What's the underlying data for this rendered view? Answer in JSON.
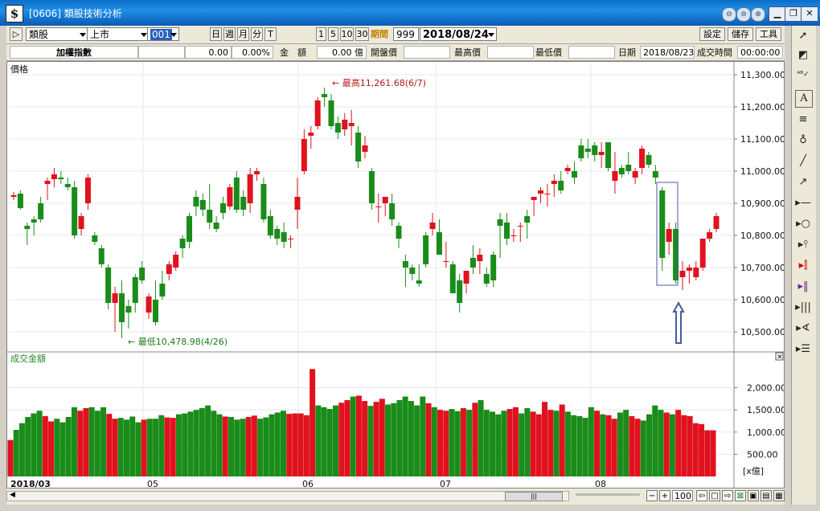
{
  "window": {
    "title": "[0606] 類股技術分析",
    "app_icon": "$",
    "controls": [
      "⊖",
      "⊜",
      "⊕"
    ],
    "min": "▁",
    "max": "❐",
    "close": "✕"
  },
  "toolbar": {
    "play_icon": "▷",
    "category": "類股",
    "market": "上市",
    "code": "001",
    "periods": [
      "日",
      "週",
      "月",
      "分",
      "T"
    ],
    "minutes": [
      "1",
      "5",
      "10",
      "30"
    ],
    "period_label": "期間",
    "period_value": "999",
    "date": "2018/08/24",
    "settings": "設定",
    "save": "儲存",
    "tools": "工具"
  },
  "info": {
    "index_name": "加權指數",
    "change": "0.00",
    "change_pct": "0.00%",
    "amount_label": "金　額",
    "amount_value": "0.00 億",
    "open_label": "開盤價",
    "high_label": "最高價",
    "low_label": "最低價",
    "date_label": "日期",
    "date_value": "2018/08/23",
    "time_label": "成交時間",
    "time_value": "00:00:00"
  },
  "price_panel": {
    "title": "價格",
    "max_label": "← 最高11,261.68(6/7)",
    "min_label": "← 最低10,478.98(4/26)"
  },
  "volume_panel": {
    "title": "成交金額",
    "unit": "[x億]",
    "close": "✕"
  },
  "bottom": {
    "zoom": "100",
    "scroll_grip": "|||"
  },
  "colors": {
    "up": "#e0121e",
    "down": "#1a8c1a",
    "highlight": "#4a5aa0"
  },
  "right_tools": [
    "cursor-icon",
    "eraser-icon",
    "spellcheck-icon",
    "text-icon",
    "equals-icon",
    "color-icon",
    "line-icon",
    "arrow-icon",
    "hline-icon",
    "circle-icon",
    "pin-icon",
    "candles-icon",
    "bars-icon",
    "lines-icon",
    "fan-icon",
    "fib-icon"
  ],
  "chart_data": [
    {
      "type": "candlestick",
      "x_ticks": [
        "2018/03",
        "05",
        "06",
        "07",
        "08"
      ],
      "y_ticks": [
        "11,300.00",
        "11,200.00",
        "11,100.00",
        "11,000.00",
        "10,900.00",
        "10,800.00",
        "10,700.00",
        "10,600.00",
        "10,500.00"
      ],
      "ylim": [
        10440,
        11330
      ],
      "grid": true,
      "candles": [
        [
          10920,
          10935,
          10910,
          10925
        ],
        [
          10930,
          10940,
          10880,
          10885
        ],
        [
          10830,
          10840,
          10770,
          10820
        ],
        [
          10850,
          10860,
          10800,
          10840
        ],
        [
          10900,
          10920,
          10840,
          10850
        ],
        [
          10960,
          10980,
          10910,
          10970
        ],
        [
          10975,
          11010,
          10950,
          10990
        ],
        [
          10980,
          11000,
          10960,
          10975
        ],
        [
          10960,
          10980,
          10940,
          10950
        ],
        [
          10950,
          10970,
          10790,
          10800
        ],
        [
          10820,
          10870,
          10800,
          10860
        ],
        [
          10900,
          10990,
          10880,
          10980
        ],
        [
          10800,
          10810,
          10770,
          10780
        ],
        [
          10760,
          10770,
          10700,
          10710
        ],
        [
          10700,
          10710,
          10570,
          10590
        ],
        [
          10590,
          10640,
          10500,
          10620
        ],
        [
          10620,
          10660,
          10480,
          10530
        ],
        [
          10580,
          10600,
          10510,
          10560
        ],
        [
          10670,
          10680,
          10560,
          10590
        ],
        [
          10700,
          10720,
          10650,
          10660
        ],
        [
          10560,
          10620,
          10540,
          10610
        ],
        [
          10600,
          10660,
          10520,
          10530
        ],
        [
          10650,
          10690,
          10600,
          10610
        ],
        [
          10680,
          10720,
          10660,
          10710
        ],
        [
          10700,
          10750,
          10690,
          10740
        ],
        [
          10790,
          10800,
          10730,
          10760
        ],
        [
          10860,
          10870,
          10760,
          10780
        ],
        [
          10920,
          10940,
          10860,
          10890
        ],
        [
          10910,
          10930,
          10860,
          10880
        ],
        [
          10880,
          10960,
          10820,
          10840
        ],
        [
          10840,
          10860,
          10810,
          10820
        ],
        [
          10900,
          10920,
          10850,
          10870
        ],
        [
          10890,
          10960,
          10880,
          10950
        ],
        [
          10980,
          11000,
          10870,
          10880
        ],
        [
          10920,
          10940,
          10860,
          10880
        ],
        [
          10900,
          11010,
          10870,
          10990
        ],
        [
          10990,
          11010,
          10970,
          11000
        ],
        [
          10960,
          10980,
          10840,
          10850
        ],
        [
          10860,
          10880,
          10790,
          10800
        ],
        [
          10820,
          10830,
          10770,
          10790
        ],
        [
          10810,
          10840,
          10760,
          10780
        ],
        [
          10790,
          10800,
          10760,
          10790
        ],
        [
          10880,
          10980,
          10820,
          10920
        ],
        [
          11000,
          11130,
          10990,
          11100
        ],
        [
          11110,
          11140,
          11070,
          11120
        ],
        [
          11140,
          11230,
          11130,
          11220
        ],
        [
          11240,
          11260,
          11200,
          11230
        ],
        [
          11220,
          11240,
          11130,
          11140
        ],
        [
          11150,
          11170,
          11100,
          11120
        ],
        [
          11130,
          11180,
          11110,
          11160
        ],
        [
          11140,
          11190,
          11080,
          11150
        ],
        [
          11120,
          11140,
          11010,
          11030
        ],
        [
          11060,
          11110,
          11040,
          11080
        ],
        [
          11000,
          11010,
          10880,
          10900
        ],
        [
          10890,
          10930,
          10840,
          10890
        ],
        [
          10900,
          10920,
          10860,
          10920
        ],
        [
          10900,
          10930,
          10830,
          10850
        ],
        [
          10830,
          10840,
          10760,
          10790
        ],
        [
          10720,
          10740,
          10640,
          10700
        ],
        [
          10700,
          10710,
          10660,
          10680
        ],
        [
          10660,
          10710,
          10640,
          10650
        ],
        [
          10800,
          10810,
          10700,
          10710
        ],
        [
          10820,
          10870,
          10800,
          10840
        ],
        [
          10810,
          10850,
          10760,
          10740
        ],
        [
          10720,
          10780,
          10700,
          10720
        ],
        [
          10710,
          10720,
          10620,
          10620
        ],
        [
          10660,
          10680,
          10560,
          10590
        ],
        [
          10650,
          10680,
          10620,
          10690
        ],
        [
          10730,
          10770,
          10680,
          10700
        ],
        [
          10720,
          10760,
          10680,
          10740
        ],
        [
          10680,
          10700,
          10640,
          10650
        ],
        [
          10740,
          10750,
          10640,
          10660
        ],
        [
          10850,
          10870,
          10730,
          10830
        ],
        [
          10840,
          10870,
          10770,
          10790
        ],
        [
          10800,
          10820,
          10780,
          10800
        ],
        [
          10830,
          10840,
          10780,
          10830
        ],
        [
          10860,
          10880,
          10790,
          10840
        ],
        [
          10910,
          10920,
          10860,
          10920
        ],
        [
          10930,
          10950,
          10900,
          10940
        ],
        [
          10930,
          10960,
          10890,
          10930
        ],
        [
          10960,
          10990,
          10920,
          10970
        ],
        [
          10970,
          11000,
          10930,
          10940
        ],
        [
          11000,
          11020,
          10990,
          11010
        ],
        [
          11000,
          11030,
          10960,
          10980
        ],
        [
          11080,
          11100,
          11030,
          11040
        ],
        [
          11070,
          11100,
          11040,
          11060
        ],
        [
          11080,
          11090,
          11030,
          11050
        ],
        [
          11050,
          11090,
          11010,
          11060
        ],
        [
          11090,
          11090,
          11000,
          11010
        ],
        [
          10970,
          11060,
          10930,
          11000
        ],
        [
          11010,
          11020,
          10980,
          10990
        ],
        [
          11020,
          11060,
          10990,
          11000
        ],
        [
          10980,
          11010,
          10960,
          11000
        ],
        [
          11010,
          11080,
          10990,
          11070
        ],
        [
          11050,
          11060,
          11010,
          11020
        ],
        [
          11000,
          11020,
          10960,
          10980
        ],
        [
          10940,
          10950,
          10690,
          10730
        ],
        [
          10780,
          10840,
          10740,
          10820
        ],
        [
          10820,
          10840,
          10650,
          10660
        ],
        [
          10670,
          10720,
          10630,
          10690
        ],
        [
          10690,
          10710,
          10650,
          10700
        ],
        [
          10670,
          10720,
          10660,
          10700
        ],
        [
          10700,
          10750,
          10690,
          10790
        ],
        [
          10790,
          10820,
          10780,
          10810
        ],
        [
          10820,
          10870,
          10810,
          10860
        ]
      ]
    },
    {
      "type": "bar",
      "y_ticks": [
        "2,000.00",
        "1,500.00",
        "1,000.00",
        "500.00"
      ],
      "ylim": [
        0,
        2400
      ],
      "values": [
        820,
        1050,
        1200,
        1340,
        1420,
        1480,
        1360,
        1240,
        1300,
        1220,
        1340,
        1560,
        1480,
        1540,
        1560,
        1480,
        1560,
        1410,
        1300,
        1320,
        1280,
        1350,
        1220,
        1280,
        1300,
        1300,
        1380,
        1330,
        1320,
        1400,
        1420,
        1460,
        1500,
        1540,
        1600,
        1480,
        1400,
        1350,
        1340,
        1280,
        1300,
        1340,
        1370,
        1300,
        1330,
        1400,
        1440,
        1480,
        1410,
        1420,
        1420,
        1380,
        2420,
        1600,
        1560,
        1520,
        1600,
        1660,
        1720,
        1800,
        1820,
        1700,
        1590,
        1680,
        1750,
        1620,
        1650,
        1720,
        1800,
        1700,
        1600,
        1800,
        1650,
        1560,
        1500,
        1480,
        1520,
        1470,
        1540,
        1500,
        1660,
        1720,
        1500,
        1460,
        1400,
        1480,
        1520,
        1560,
        1420,
        1540,
        1460,
        1400,
        1680,
        1500,
        1480,
        1620,
        1460,
        1380,
        1360,
        1320,
        1560,
        1480,
        1400,
        1380,
        1300,
        1440,
        1500,
        1360,
        1300,
        1260,
        1400,
        1600,
        1500,
        1440,
        1400,
        1500,
        1380,
        1360,
        1200,
        1180,
        1040,
        1040
      ]
    }
  ]
}
